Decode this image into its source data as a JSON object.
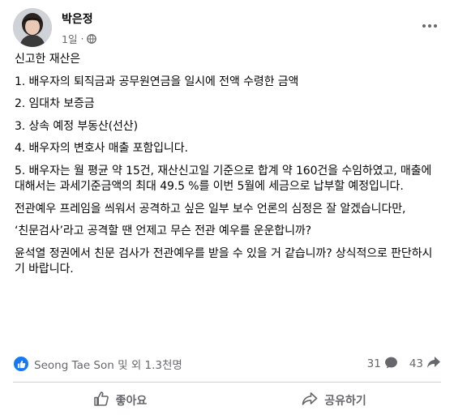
{
  "post": {
    "author": "박은정",
    "time": "1일",
    "paragraphs": [
      "신고한 재산은",
      "1. 배우자의 퇴직금과 공무원연금을 일시에 전액 수령한 금액",
      "2. 임대차 보증금",
      "3. 상속 예정 부동산(선산)",
      "4. 배우자의 변호사 매출 포함입니다.",
      "5. 배우자는 월 평균 약 15건, 재산신고일 기준으로 합계 약 160건을 수임하였고, 매출에 대해서는 과세기준금액의 최대 49.5 %를 이번 5월에 세금으로 납부할 예정입니다.",
      "전관예우 프레임을 씌워서 공격하고 싶은 일부 보수 언론의 심정은 잘 알겠습니다만,",
      "‘친문검사’라고 공격할 땐 언제고 무슨 전관 예우를 운운합니까?",
      "윤석열 정권에서 친문 검사가 전관예우를 받을 수 있을 거 같습니까? 상식적으로 판단하시기 바랍니다."
    ]
  },
  "stats": {
    "reactions_text": "Seong Tae Son 및 외 1.3천명",
    "comments": "31",
    "shares": "43"
  },
  "actions": {
    "like": "좋아요",
    "share": "공유하기"
  },
  "colors": {
    "text": "#050505",
    "secondary": "#65676b",
    "accent": "#1877f2",
    "divider": "#ced0d4"
  },
  "icons": {
    "globe": "globe-icon",
    "more": "more-options-icon",
    "like_reaction": "thumbs-up-icon",
    "comment": "comment-icon",
    "share": "share-arrow-icon"
  }
}
